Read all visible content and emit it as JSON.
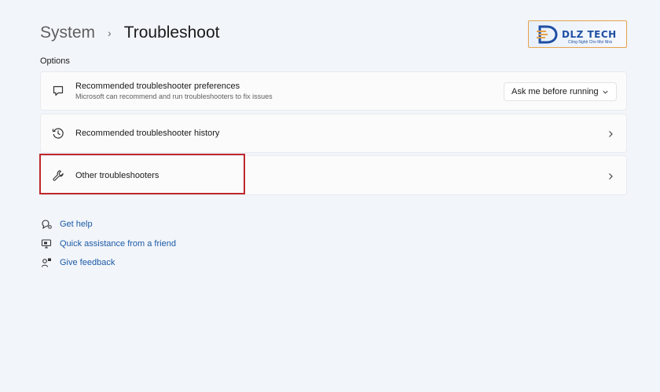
{
  "breadcrumb": {
    "parent": "System",
    "separator": "›",
    "current": "Troubleshoot"
  },
  "logo": {
    "text": "DLZ TECH",
    "tagline": "Công Nghệ Cho Mọi Nhà"
  },
  "section_title": "Options",
  "cards": [
    {
      "title": "Recommended troubleshooter preferences",
      "subtitle": "Microsoft can recommend and run troubleshooters to fix issues",
      "icon": "chat-bubble-icon",
      "dropdown_value": "Ask me before running"
    },
    {
      "title": "Recommended troubleshooter history",
      "icon": "history-icon"
    },
    {
      "title": "Other troubleshooters",
      "icon": "wrench-icon"
    }
  ],
  "links": [
    {
      "label": "Get help",
      "icon": "help-icon"
    },
    {
      "label": "Quick assistance from a friend",
      "icon": "remote-assist-icon"
    },
    {
      "label": "Give feedback",
      "icon": "feedback-icon"
    }
  ],
  "colors": {
    "background": "#f2f5fa",
    "link": "#1b5aa6",
    "highlight": "#c0272d"
  }
}
